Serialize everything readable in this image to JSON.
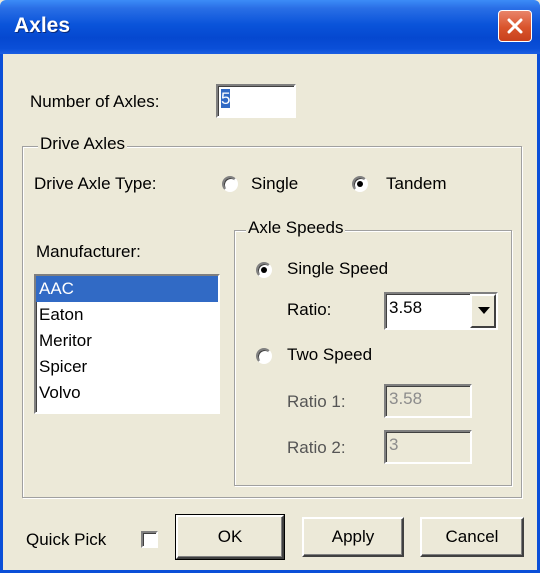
{
  "window": {
    "title": "Axles"
  },
  "number_of_axles": {
    "label": "Number of Axles:",
    "value": "5"
  },
  "drive_axles": {
    "group_label": "Drive Axles",
    "type_label": "Drive Axle Type:",
    "single_label": "Single",
    "tandem_label": "Tandem",
    "selected": "Tandem"
  },
  "manufacturer": {
    "label": "Manufacturer:",
    "items": [
      "AAC",
      "Eaton",
      "Meritor",
      "Spicer",
      "Volvo"
    ],
    "selected": "AAC"
  },
  "axle_speeds": {
    "group_label": "Axle Speeds",
    "single_speed_label": "Single Speed",
    "ratio_label": "Ratio:",
    "ratio_value": "3.58",
    "two_speed_label": "Two Speed",
    "ratio1_label": "Ratio 1:",
    "ratio1_value": "3.58",
    "ratio2_label": "Ratio 2:",
    "ratio2_value": "3",
    "selected": "Single Speed"
  },
  "footer": {
    "quick_pick_label": "Quick Pick",
    "quick_pick_checked": false,
    "ok_label": "OK",
    "apply_label": "Apply",
    "cancel_label": "Cancel"
  },
  "colors": {
    "titlebar": "#0a54da",
    "dialog_bg": "#ece9d8",
    "selection": "#316ac5",
    "close_button": "#d9542c"
  },
  "icons": {
    "close": "close-icon"
  }
}
